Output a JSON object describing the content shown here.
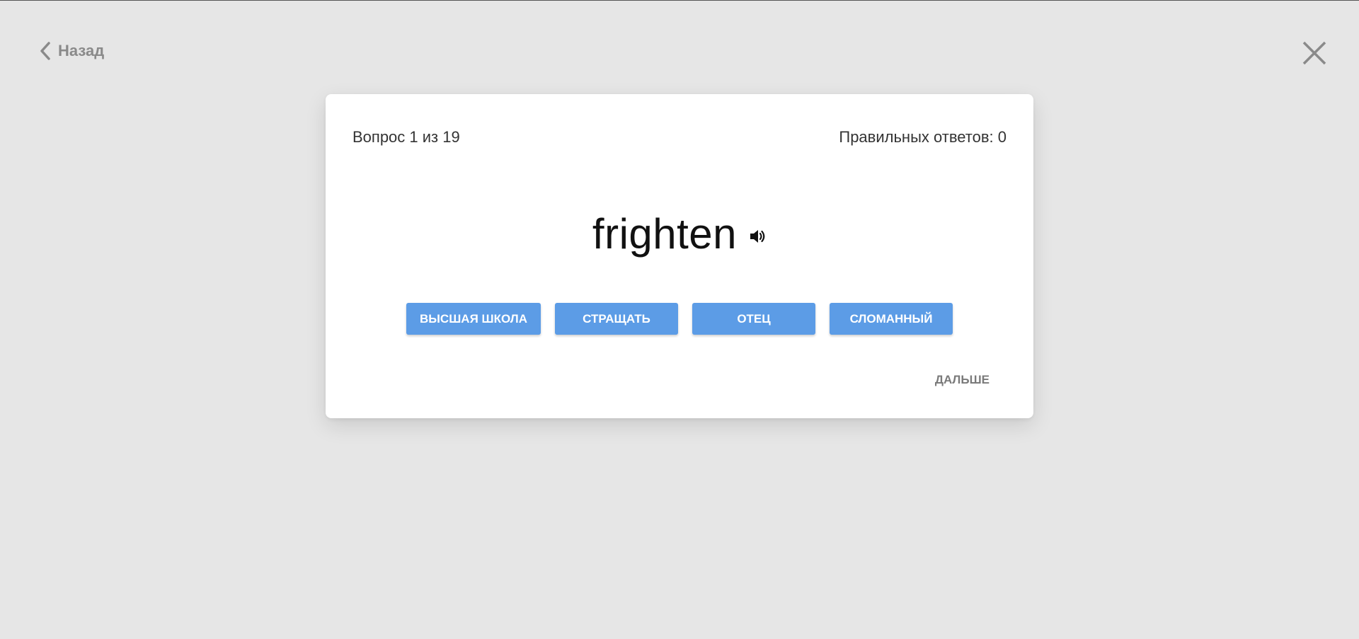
{
  "nav": {
    "back_label": "Назад",
    "back_icon": "chevron-left-icon",
    "close_icon": "close-icon"
  },
  "quiz": {
    "question_counter": "Вопрос 1 из 19",
    "correct_counter": "Правильных ответов: 0",
    "word": "frighten",
    "audio_icon": "speaker-icon",
    "options": [
      {
        "label": "ВЫСШАЯ ШКОЛА"
      },
      {
        "label": "СТРАЩАТЬ"
      },
      {
        "label": "ОТЕЦ"
      },
      {
        "label": "СЛОМАННЫЙ"
      }
    ],
    "next_label": "ДАЛЬШЕ"
  },
  "colors": {
    "background": "#e6e6e6",
    "card": "#ffffff",
    "option_button": "#5c9ce6",
    "muted_text": "#8a8a8a"
  }
}
